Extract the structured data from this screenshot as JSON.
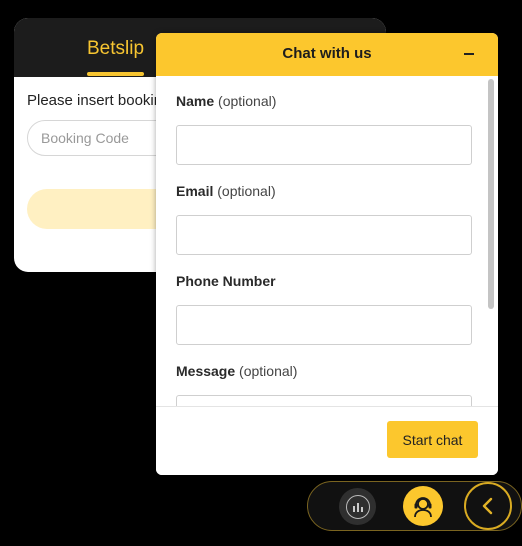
{
  "betslip": {
    "tab_label": "Betslip",
    "prompt": "Please insert bookin",
    "booking_placeholder": "Booking Code"
  },
  "chat": {
    "title": "Chat with us",
    "fields": [
      {
        "label": "Name",
        "optional": "(optional)",
        "value": ""
      },
      {
        "label": "Email",
        "optional": "(optional)",
        "value": ""
      },
      {
        "label": "Phone Number",
        "optional": "",
        "value": ""
      },
      {
        "label": "Message",
        "optional": "(optional)",
        "value": ""
      }
    ],
    "start_button": "Start chat"
  },
  "dock": {
    "icons": [
      "stats-icon",
      "support-headset-icon",
      "chevron-left-icon"
    ]
  },
  "colors": {
    "accent": "#fcc72d",
    "betslip_header": "#1c1c1c",
    "betslip_accent": "#f7c531"
  }
}
